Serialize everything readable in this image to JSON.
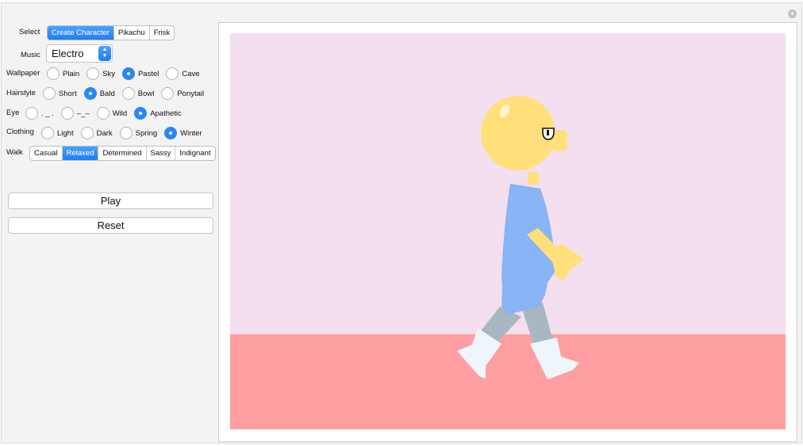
{
  "select": {
    "label": "Select",
    "options": [
      "Create Character",
      "Pikachu",
      "Frisk"
    ],
    "selected": 0
  },
  "music": {
    "label": "Music",
    "value": "Electro"
  },
  "wallpaper": {
    "label": "Wallpaper",
    "options": [
      "Plain",
      "Sky",
      "Pastel",
      "Cave"
    ],
    "selected": 2
  },
  "hairstyle": {
    "label": "Hairstyle",
    "options": [
      "Short",
      "Bald",
      "Bowl",
      "Ponytail"
    ],
    "selected": 1
  },
  "eye": {
    "label": "Eye",
    "options": [
      ". _ .",
      "–_–",
      "Wild",
      "Apathetic"
    ],
    "selected": 3
  },
  "clothing": {
    "label": "Clothing",
    "options": [
      "Light",
      "Dark",
      "Spring",
      "Winter"
    ],
    "selected": 3
  },
  "walk": {
    "label": "Walk",
    "options": [
      "Casual",
      "Relaxed",
      "Determined",
      "Sassy",
      "Indignant"
    ],
    "selected": 1
  },
  "buttons": {
    "play": "Play",
    "reset": "Reset"
  },
  "icons": {
    "corner": "plus-circle-icon"
  },
  "colors": {
    "accent": "#1f7ef4",
    "sky": "#f3dfef",
    "ground": "#ff9ea0",
    "skin": "#ffe07a",
    "shirt": "#89b4f5",
    "sleeve_back": "#3c5f95",
    "pants": "#a9b7c3",
    "boots": "#eef6fc"
  }
}
